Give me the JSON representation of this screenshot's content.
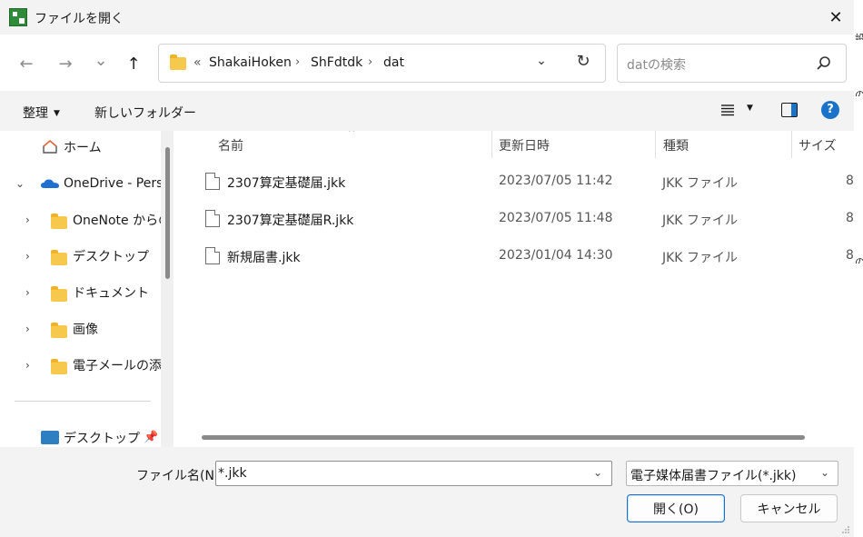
{
  "window": {
    "title": "ファイルを開く",
    "close_glyph": "✕"
  },
  "navigation": {
    "back_glyph": "←",
    "forward_glyph": "→",
    "recent_glyph": "⌄",
    "up_glyph": "↑"
  },
  "address": {
    "overflow_glyph": "«",
    "crumbs": [
      "ShakaiHoken",
      "ShFdtdk",
      "dat"
    ],
    "separator": "›",
    "dropdown_glyph": "⌄",
    "refresh_glyph": "↻"
  },
  "search": {
    "placeholder": "datの検索"
  },
  "toolbar": {
    "organize_label": "整理",
    "new_folder_label": "新しいフォルダー",
    "caret_glyph": "▼",
    "help_glyph": "?"
  },
  "sidebar": {
    "items": [
      {
        "label": "ホーム",
        "chevron": ""
      },
      {
        "label": "OneDrive - Perso",
        "chevron": "⌄"
      },
      {
        "label": "OneNote からの",
        "chevron": "›"
      },
      {
        "label": "デスクトップ",
        "chevron": "›"
      },
      {
        "label": "ドキュメント",
        "chevron": "›"
      },
      {
        "label": "画像",
        "chevron": "›"
      },
      {
        "label": "電子メールの添付",
        "chevron": "›"
      },
      {
        "label": "デスクトップ",
        "chevron": ""
      }
    ],
    "pin_glyph": "📌"
  },
  "file_list": {
    "sort_glyph": "^",
    "columns": [
      "名前",
      "更新日時",
      "種類",
      "サイズ"
    ],
    "rows": [
      {
        "name": "2307算定基礎届.jkk",
        "modified": "2023/07/05 11:42",
        "type": "JKK ファイル",
        "size": "8"
      },
      {
        "name": "2307算定基礎届R.jkk",
        "modified": "2023/07/05 11:48",
        "type": "JKK ファイル",
        "size": "8"
      },
      {
        "name": "新規届書.jkk",
        "modified": "2023/01/04 14:30",
        "type": "JKK ファイル",
        "size": "8"
      }
    ]
  },
  "footer": {
    "filename_label": "ファイル名(N):",
    "filename_value": "*.jkk",
    "dropdown_glyph": "⌄",
    "filter_value": "電子媒体届書ファイル(*.jkk)",
    "open_label": "開く(O)",
    "cancel_label": "キャンセル"
  },
  "background": {
    "edge_glyphs": [
      "設",
      "の",
      "の"
    ]
  },
  "colors": {
    "accent": "#1a73c8",
    "folder": "#f6c94c",
    "app_icon": "#2e8b3a"
  }
}
